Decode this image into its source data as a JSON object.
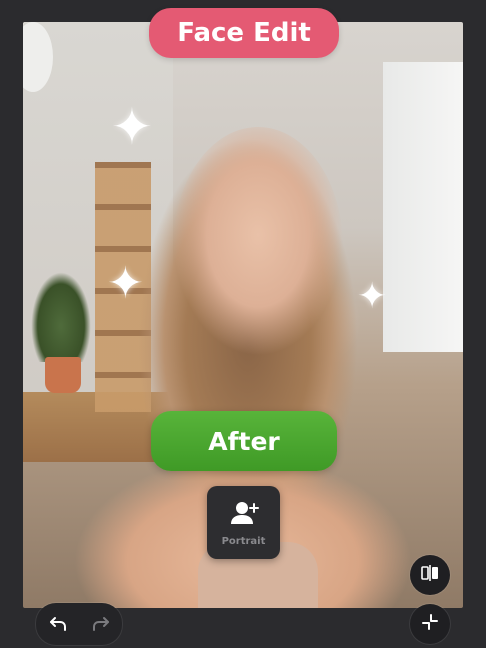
{
  "header": {
    "title": "Face Edit"
  },
  "compare": {
    "label": "After"
  },
  "tool": {
    "label": "Portrait",
    "icon": "add-person-icon"
  },
  "controls": {
    "compare_icon": "compare-split-icon",
    "undo_icon": "undo-icon",
    "redo_icon": "redo-icon",
    "collapse_icon": "collapse-icon"
  },
  "colors": {
    "title_pill": "#e45a73",
    "after_pill": "#4aa52f",
    "dark_surface": "#2b2b2e"
  }
}
